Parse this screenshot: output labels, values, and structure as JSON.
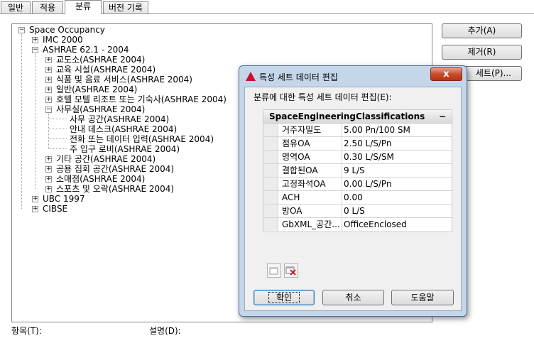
{
  "tabs": [
    {
      "label": "일반",
      "active": false
    },
    {
      "label": "적용",
      "active": false
    },
    {
      "label": "분류",
      "active": true
    },
    {
      "label": "버전 기록",
      "active": false
    }
  ],
  "tree": {
    "root": "Space Occupancy",
    "imc": "IMC 2000",
    "ashrae": "ASHRAE 62.1 - 2004",
    "cat1": "교도소(ASHRAE 2004)",
    "cat2": "교육 시설(ASHRAE 2004)",
    "cat3": "식품 및 음료 서비스(ASHRAE 2004)",
    "cat4": "일반(ASHRAE 2004)",
    "cat5": "호텔 모텔 리조트 또는 기숙사(ASHRAE 2004)",
    "cat6": "사무실(ASHRAE 2004)",
    "sub1": "사무 공간(ASHRAE 2004)",
    "sub2": "안내 데스크(ASHRAE 2004)",
    "sub3": "전화 또는 데이터 입력(ASHRAE 2004)",
    "sub4": "주 입구 로비(ASHRAE 2004)",
    "cat7": "기타 공간(ASHRAE 2004)",
    "cat8": "공용 집회 공간(ASHRAE 2004)",
    "cat9": "소매점(ASHRAE 2004)",
    "cat10": "스포츠 및 오락(ASHRAE 2004)",
    "ubc": "UBC 1997",
    "cibse": "CIBSE"
  },
  "buttons": {
    "add": "추가(A)",
    "remove": "제거(R)",
    "propset": "세트(P)..."
  },
  "bottom": {
    "item_label": "항목(T):",
    "desc_label": "설명(D):"
  },
  "dialog": {
    "title": "특성 세트 데이터 편집",
    "close": "x",
    "subtitle": "분류에 대한 특성 세트 데이터 편집(E):",
    "group": "SpaceEngineeringClassifications",
    "collapse": "−",
    "rows": [
      {
        "key": "거주자밀도",
        "value": "5.00 Pn/100 SM"
      },
      {
        "key": "점유OA",
        "value": "2.50  L/S/Pn"
      },
      {
        "key": "영역OA",
        "value": "0.30 L/S/SM"
      },
      {
        "key": "결합된OA",
        "value": "9 L/S"
      },
      {
        "key": "고정좌석OA",
        "value": "0.00  L/S/Pn"
      },
      {
        "key": "ACH",
        "value": "0.00"
      },
      {
        "key": "방OA",
        "value": "0 L/S"
      },
      {
        "key": "GbXML_공간...",
        "value": "OfficeEnclosed"
      }
    ],
    "ok": "확인",
    "cancel": "취소",
    "help": "도움말"
  },
  "colors": {
    "dialog_frame": "#c6d6ea",
    "close_button": "#c74b2c",
    "autocad_logo": "#c8102e"
  }
}
